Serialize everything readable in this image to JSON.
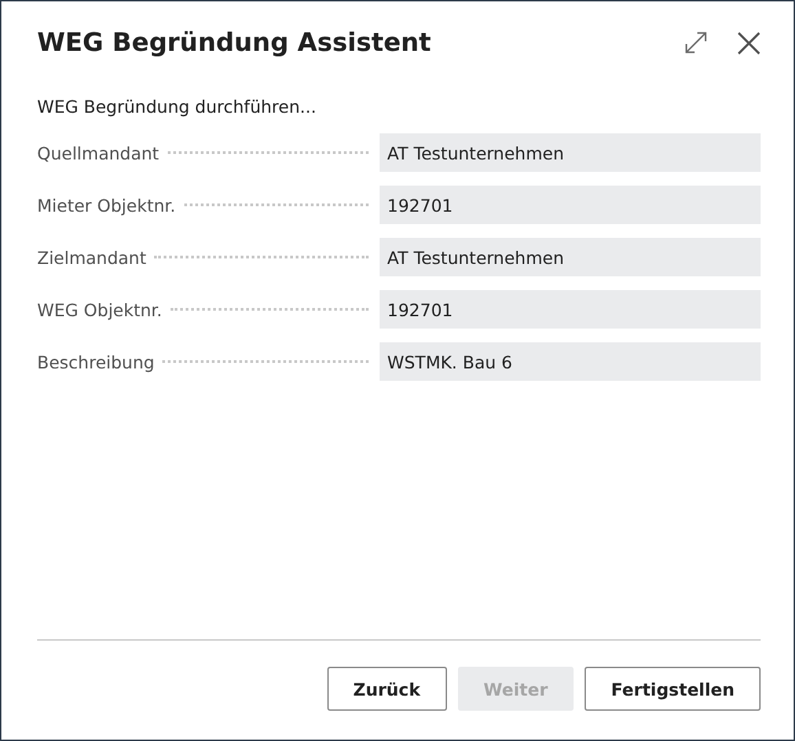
{
  "window": {
    "title": "WEG Begründung Assistent"
  },
  "subtitle": "WEG Begründung durchführen...",
  "fields": [
    {
      "label": "Quellmandant",
      "value": "AT Testunternehmen"
    },
    {
      "label": "Mieter Objektnr.",
      "value": "192701"
    },
    {
      "label": "Zielmandant",
      "value": "AT Testunternehmen"
    },
    {
      "label": "WEG Objektnr.",
      "value": "192701"
    },
    {
      "label": "Beschreibung",
      "value": "WSTMK. Bau 6"
    }
  ],
  "buttons": [
    {
      "label": "Zurück",
      "disabled": false
    },
    {
      "label": "Weiter",
      "disabled": true
    },
    {
      "label": "Fertigstellen",
      "disabled": false
    }
  ]
}
